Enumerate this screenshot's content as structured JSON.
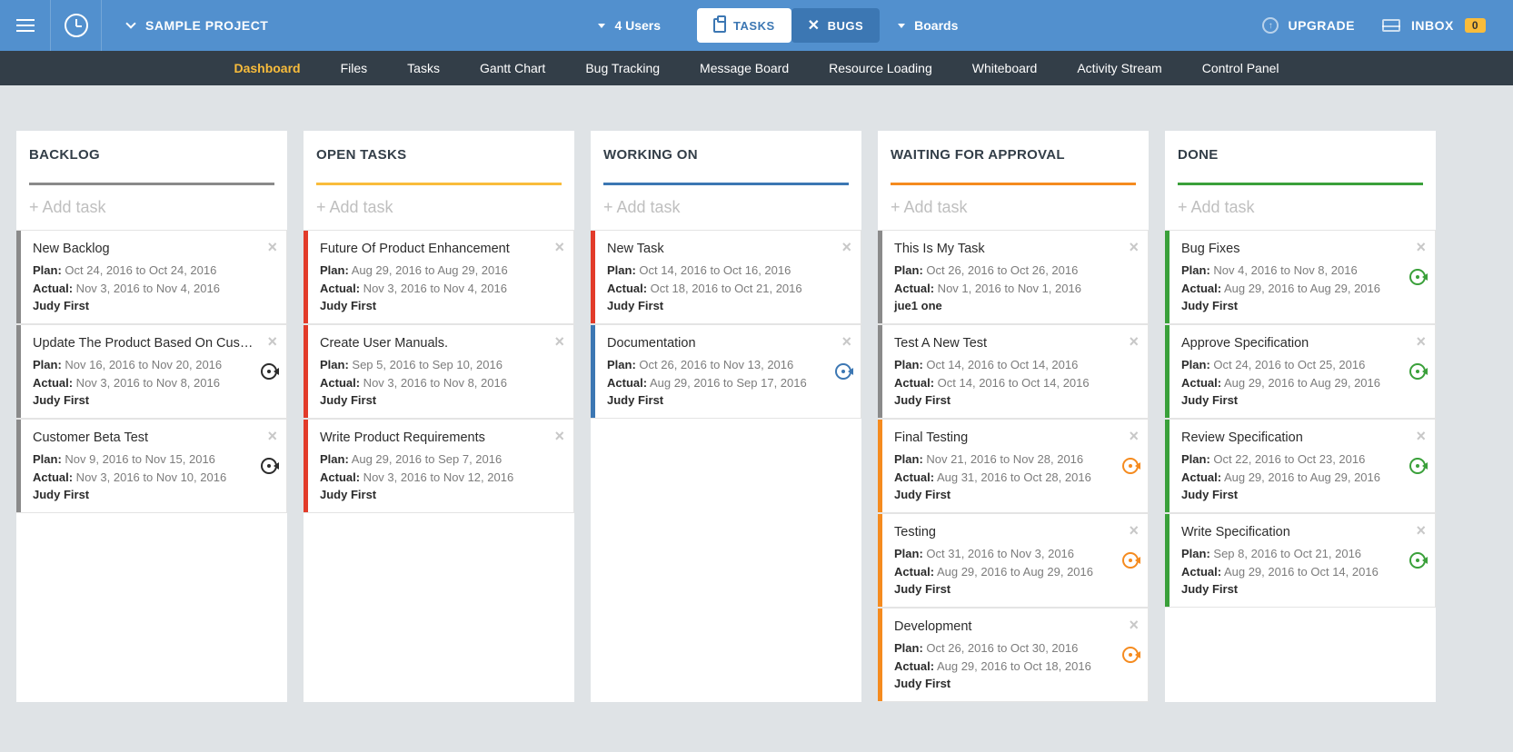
{
  "header": {
    "project_name": "SAMPLE PROJECT",
    "users_label": "4 Users",
    "tasks_btn": "TASKS",
    "bugs_btn": "BUGS",
    "boards_label": "Boards",
    "upgrade_label": "UPGRADE",
    "inbox_label": "INBOX",
    "inbox_count": "0"
  },
  "subnav": {
    "items": [
      "Dashboard",
      "Files",
      "Tasks",
      "Gantt Chart",
      "Bug Tracking",
      "Message Board",
      "Resource Loading",
      "Whiteboard",
      "Activity Stream",
      "Control Panel"
    ],
    "active_index": 0
  },
  "add_task_placeholder": "+ Add task",
  "labels": {
    "plan": "Plan:",
    "actual": "Actual:"
  },
  "columns": [
    {
      "title": "BACKLOG",
      "color": "#8a8a8a",
      "cards": [
        {
          "title": "New Backlog",
          "plan": "Oct 24, 2016 to Oct 24, 2016",
          "actual": "Nov 3, 2016 to Nov 4, 2016",
          "assignee": "Judy First",
          "stripe": "#8a8a8a",
          "badge": null
        },
        {
          "title": "Update The Product Based On Custo...",
          "plan": "Nov 16, 2016 to Nov 20, 2016",
          "actual": "Nov 3, 2016 to Nov 8, 2016",
          "assignee": "Judy First",
          "stripe": "#8a8a8a",
          "badge": "#2c2c2c"
        },
        {
          "title": "Customer Beta Test",
          "plan": "Nov 9, 2016 to Nov 15, 2016",
          "actual": "Nov 3, 2016 to Nov 10, 2016",
          "assignee": "Judy First",
          "stripe": "#8a8a8a",
          "badge": "#2c2c2c"
        }
      ]
    },
    {
      "title": "OPEN TASKS",
      "color": "#f9bc3b",
      "cards": [
        {
          "title": "Future Of Product Enhancement",
          "plan": "Aug 29, 2016 to Aug 29, 2016",
          "actual": "Nov 3, 2016 to Nov 4, 2016",
          "assignee": "Judy First",
          "stripe": "#e23b2a",
          "badge": null
        },
        {
          "title": "Create User Manuals.",
          "plan": "Sep 5, 2016 to Sep 10, 2016",
          "actual": "Nov 3, 2016 to Nov 8, 2016",
          "assignee": "Judy First",
          "stripe": "#e23b2a",
          "badge": null
        },
        {
          "title": "Write Product Requirements",
          "plan": "Aug 29, 2016 to Sep 7, 2016",
          "actual": "Nov 3, 2016 to Nov 12, 2016",
          "assignee": "Judy First",
          "stripe": "#e23b2a",
          "badge": null
        }
      ]
    },
    {
      "title": "WORKING ON",
      "color": "#3c77b3",
      "cards": [
        {
          "title": "New Task",
          "plan": "Oct 14, 2016 to Oct 16, 2016",
          "actual": "Oct 18, 2016 to Oct 21, 2016",
          "assignee": "Judy First",
          "stripe": "#e23b2a",
          "badge": null
        },
        {
          "title": "Documentation",
          "plan": "Oct 26, 2016 to Nov 13, 2016",
          "actual": "Aug 29, 2016 to Sep 17, 2016",
          "assignee": "Judy First",
          "stripe": "#3c77b3",
          "badge": "#3c77b3"
        }
      ]
    },
    {
      "title": "WAITING FOR APPROVAL",
      "color": "#f58b1f",
      "cards": [
        {
          "title": "This Is My Task",
          "plan": "Oct 26, 2016 to Oct 26, 2016",
          "actual": "Nov 1, 2016 to Nov 1, 2016",
          "assignee": "jue1 one",
          "stripe": "#8a8a8a",
          "badge": null
        },
        {
          "title": "Test A New Test",
          "plan": "Oct 14, 2016 to Oct 14, 2016",
          "actual": "Oct 14, 2016 to Oct 14, 2016",
          "assignee": "Judy First",
          "stripe": "#8a8a8a",
          "badge": null
        },
        {
          "title": "Final Testing",
          "plan": "Nov 21, 2016 to Nov 28, 2016",
          "actual": "Aug 31, 2016 to Oct 28, 2016",
          "assignee": "Judy First",
          "stripe": "#f58b1f",
          "badge": "#f58b1f"
        },
        {
          "title": "Testing",
          "plan": "Oct 31, 2016 to Nov 3, 2016",
          "actual": "Aug 29, 2016 to Aug 29, 2016",
          "assignee": "Judy First",
          "stripe": "#f58b1f",
          "badge": "#f58b1f"
        },
        {
          "title": "Development",
          "plan": "Oct 26, 2016 to Oct 30, 2016",
          "actual": "Aug 29, 2016 to Oct 18, 2016",
          "assignee": "Judy First",
          "stripe": "#f58b1f",
          "badge": "#f58b1f"
        }
      ]
    },
    {
      "title": "DONE",
      "color": "#3aa03a",
      "cards": [
        {
          "title": "Bug Fixes",
          "plan": "Nov 4, 2016 to Nov 8, 2016",
          "actual": "Aug 29, 2016 to Aug 29, 2016",
          "assignee": "Judy First",
          "stripe": "#3aa03a",
          "badge": "#3aa03a"
        },
        {
          "title": "Approve Specification",
          "plan": "Oct 24, 2016 to Oct 25, 2016",
          "actual": "Aug 29, 2016 to Aug 29, 2016",
          "assignee": "Judy First",
          "stripe": "#3aa03a",
          "badge": "#3aa03a"
        },
        {
          "title": "Review Specification",
          "plan": "Oct 22, 2016 to Oct 23, 2016",
          "actual": "Aug 29, 2016 to Aug 29, 2016",
          "assignee": "Judy First",
          "stripe": "#3aa03a",
          "badge": "#3aa03a"
        },
        {
          "title": "Write Specification",
          "plan": "Sep 8, 2016 to Oct 21, 2016",
          "actual": "Aug 29, 2016 to Oct 14, 2016",
          "assignee": "Judy First",
          "stripe": "#3aa03a",
          "badge": "#3aa03a"
        }
      ]
    }
  ]
}
